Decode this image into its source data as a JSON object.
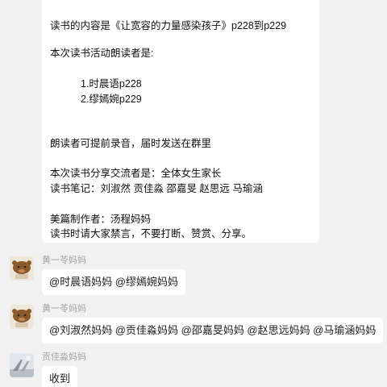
{
  "announcement": {
    "lines": [
      "读书的内容是《让宽容的力量感染孩子》p228到p229",
      "本次读书活动朗读者是:",
      "1.时晨语p228",
      "2.缪嫣婉p229",
      "朗读者可提前录音，届时发送在群里",
      "本次读书分享交流者是：全体女生家长",
      "读书笔记：刘淑然 贡佳淼 邵嘉旻 赵思远 马瑜涵",
      "美篇制作者：汤程妈妈",
      "读书时请大家禁言，不要打断、赞赏、分享。"
    ]
  },
  "messages": [
    {
      "sender": "黄一苓妈妈",
      "avatar": "bear-avatar-icon",
      "text": "@时晨语妈妈 @缪嫣婉妈妈"
    },
    {
      "sender": "黄一苓妈妈",
      "avatar": "bear-avatar-icon",
      "text": "@刘淑然妈妈 @贡佳淼妈妈 @邵嘉旻妈妈 @赵思远妈妈 @马瑜涵妈妈"
    },
    {
      "sender": "贡佳淼妈妈",
      "avatar": "scene-avatar-icon",
      "text": "收到"
    }
  ]
}
